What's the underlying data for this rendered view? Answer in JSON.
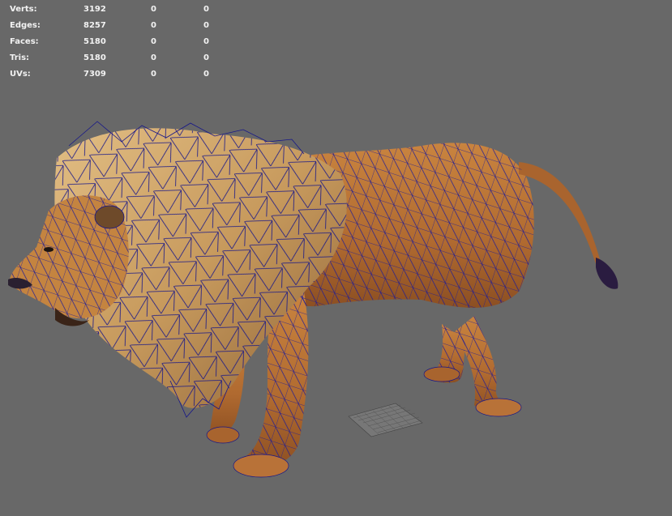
{
  "hud": {
    "rows": [
      {
        "label": "Verts:",
        "total": "3192",
        "selected": "0",
        "component": "0"
      },
      {
        "label": "Edges:",
        "total": "8257",
        "selected": "0",
        "component": "0"
      },
      {
        "label": "Faces:",
        "total": "5180",
        "selected": "0",
        "component": "0"
      },
      {
        "label": "Tris:",
        "total": "5180",
        "selected": "0",
        "component": "0"
      },
      {
        "label": "UVs:",
        "total": "7309",
        "selected": "0",
        "component": "0"
      }
    ]
  },
  "colors": {
    "background": "#686868",
    "wireframe": "#1a1a9a",
    "body": "#b9733a",
    "mane": "#c79a5d",
    "text": "#f2f2f2"
  }
}
